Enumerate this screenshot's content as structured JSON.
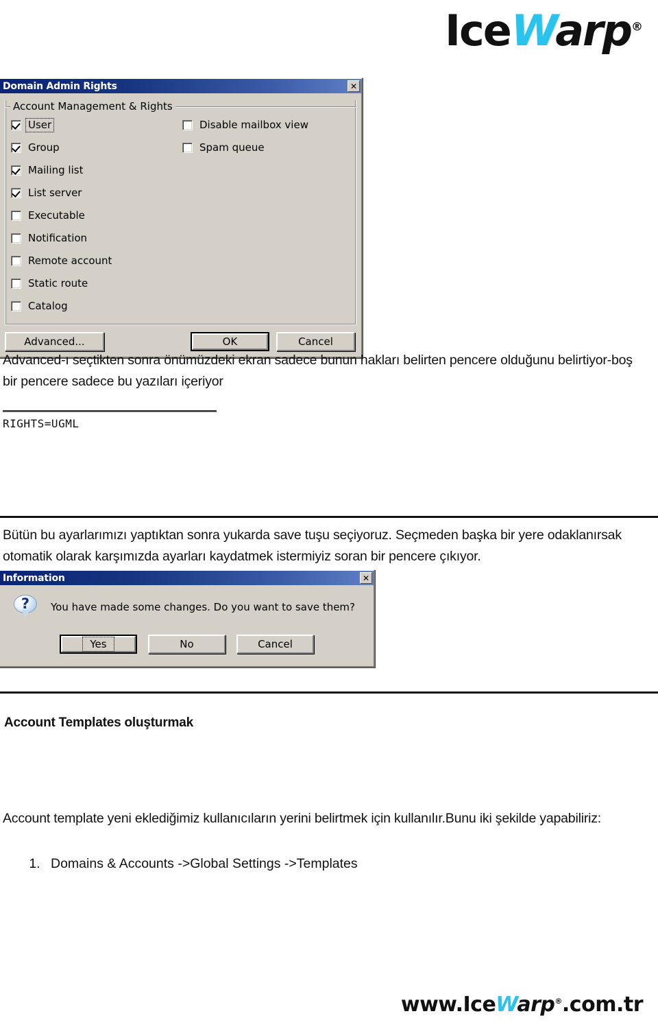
{
  "brand": {
    "logo_part1": "Ice",
    "logo_part2": "W",
    "logo_part3": "arp",
    "logo_reg": "®",
    "footer_prefix": "www.",
    "footer_part1": "Ice",
    "footer_part2": "W",
    "footer_part3": "arp",
    "footer_reg": "®",
    "footer_suffix": ".com.tr",
    "accent_color": "#29c3ee",
    "text_color": "#111111"
  },
  "rights_dialog": {
    "title": "Domain Admin Rights",
    "close_icon": "close-icon",
    "close_label": "✕",
    "group_label": "Account Management & Rights",
    "left_checkboxes": [
      {
        "label": "User",
        "checked": true,
        "focused": true
      },
      {
        "label": "Group",
        "checked": true,
        "focused": false
      },
      {
        "label": "Mailing list",
        "checked": true,
        "focused": false
      },
      {
        "label": "List server",
        "checked": true,
        "focused": false
      },
      {
        "label": "Executable",
        "checked": false,
        "focused": false
      },
      {
        "label": "Notification",
        "checked": false,
        "focused": false
      },
      {
        "label": "Remote account",
        "checked": false,
        "focused": false
      },
      {
        "label": "Static route",
        "checked": false,
        "focused": false
      },
      {
        "label": "Catalog",
        "checked": false,
        "focused": false
      }
    ],
    "right_checkboxes": [
      {
        "label": "Disable mailbox view",
        "checked": false
      },
      {
        "label": "Spam queue",
        "checked": false
      }
    ],
    "buttons": {
      "advanced": "Advanced...",
      "ok": "OK",
      "cancel": "Cancel"
    }
  },
  "body": {
    "paragraph1": "Advanced-ı seçtikten sonra önümüzdeki ekran sadece bunun hakları belirten pencere olduğunu belirtiyor-boş bir pencere sadece bu yazıları içeriyor",
    "code_line": "RIGHTS=UGML",
    "paragraph2": "Bütün bu ayarlarımızı yaptıktan sonra yukarda save tuşu seçiyoruz. Seçmeden başka bir yere odaklanırsak otomatik olarak karşımızda ayarları kaydatmek istermiyiz soran bir pencere çıkıyor.",
    "heading": "Account Templates oluşturmak",
    "paragraph3": "Account template yeni eklediğimiz kullanıcıların yerini belirtmek için kullanılır.Bunu iki şekilde yapabiliriz:",
    "step1": "Domains & Accounts ->Global Settings ->Templates"
  },
  "info_dialog": {
    "title": "Information",
    "close_label": "✕",
    "icon": "question-bubble-icon",
    "icon_glyph": "?",
    "message": "You have made some changes. Do you want to save them?",
    "buttons": {
      "yes": "Yes",
      "no": "No",
      "cancel": "Cancel"
    }
  }
}
